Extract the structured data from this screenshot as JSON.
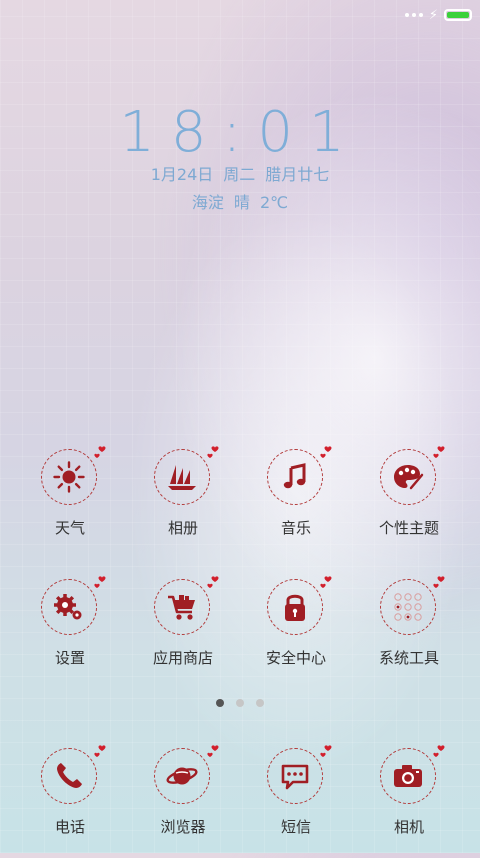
{
  "status_bar": {
    "battery_level": 1.0,
    "charging": true,
    "battery_color": "#3bd13b"
  },
  "lockscreen": {
    "time": "18:01",
    "date": "1月24日",
    "weekday": "周二",
    "lunar_date": "腊月廿七",
    "location": "海淀",
    "weather": "晴",
    "temperature": "2℃"
  },
  "apps": [
    {
      "label": "天气",
      "icon": "sun-icon"
    },
    {
      "label": "相册",
      "icon": "sailboat-icon"
    },
    {
      "label": "音乐",
      "icon": "music-note-icon"
    },
    {
      "label": "个性主题",
      "icon": "palette-icon"
    },
    {
      "label": "设置",
      "icon": "gears-icon"
    },
    {
      "label": "应用商店",
      "icon": "shopping-cart-icon"
    },
    {
      "label": "安全中心",
      "icon": "padlock-icon"
    },
    {
      "label": "系统工具",
      "icon": "tools-folder-icon"
    }
  ],
  "page_indicator": {
    "pages": 3,
    "current": 1
  },
  "dock": [
    {
      "label": "电话",
      "icon": "phone-icon"
    },
    {
      "label": "浏览器",
      "icon": "planet-icon"
    },
    {
      "label": "短信",
      "icon": "chat-bubble-icon"
    },
    {
      "label": "相机",
      "icon": "camera-icon"
    }
  ],
  "colors": {
    "accent": "#a01e24",
    "clock": "#7faed8",
    "label": "#333333"
  }
}
